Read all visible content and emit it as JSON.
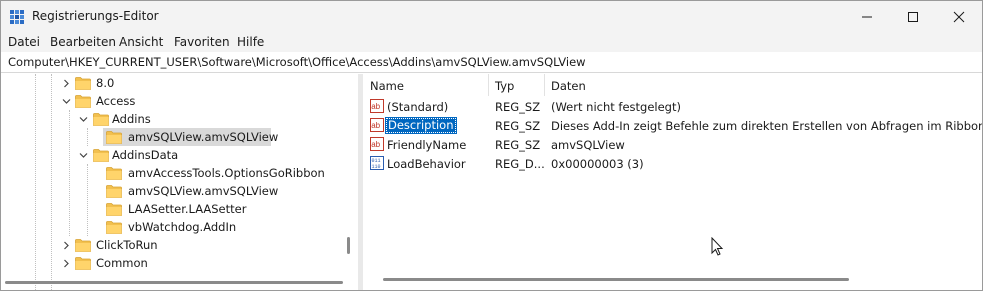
{
  "window": {
    "title": "Registrierungs-Editor",
    "accent_color": "#0067c0"
  },
  "title_buttons": {
    "minimize_icon": "minimize-icon",
    "maximize_icon": "maximize-icon",
    "close_icon": "close-icon"
  },
  "menu": [
    "Datei",
    "Bearbeiten",
    "Ansicht",
    "Favoriten",
    "Hilfe"
  ],
  "address": {
    "path": "Computer\\HKEY_CURRENT_USER\\Software\\Microsoft\\Office\\Access\\Addins\\amvSQLView.amvSQLView"
  },
  "tree": {
    "nodes": [
      {
        "label": "8.0",
        "level": 3,
        "expander": "collapsed"
      },
      {
        "label": "Access",
        "level": 3,
        "expander": "expanded"
      },
      {
        "label": "Addins",
        "level": 4,
        "expander": "expanded"
      },
      {
        "label": "amvSQLView.amvSQLView",
        "level": 5,
        "expander": "none",
        "selected": true
      },
      {
        "label": "AddinsData",
        "level": 4,
        "expander": "expanded"
      },
      {
        "label": "amvAccessTools.OptionsGoRibbon",
        "level": 5,
        "expander": "none"
      },
      {
        "label": "amvSQLView.amvSQLView",
        "level": 5,
        "expander": "none"
      },
      {
        "label": "LAASetter.LAASetter",
        "level": 5,
        "expander": "none"
      },
      {
        "label": "vbWatchdog.AddIn",
        "level": 5,
        "expander": "none"
      },
      {
        "label": "ClickToRun",
        "level": 3,
        "expander": "collapsed"
      },
      {
        "label": "Common",
        "level": 3,
        "expander": "collapsed"
      }
    ]
  },
  "values": {
    "columns": {
      "name": "Name",
      "type": "Typ",
      "data": "Daten"
    },
    "rows": [
      {
        "name": "(Standard)",
        "type": "REG_SZ",
        "data": "(Wert nicht festgelegt)",
        "icon": "string-value-icon"
      },
      {
        "name": "Description",
        "type": "REG_SZ",
        "data": "Dieses Add-In zeigt Befehle zum direkten Erstellen von Abfragen im Ribbon an.",
        "icon": "string-value-icon",
        "selected": true
      },
      {
        "name": "FriendlyName",
        "type": "REG_SZ",
        "data": "amvSQLView",
        "icon": "string-value-icon"
      },
      {
        "name": "LoadBehavior",
        "type": "REG_D...",
        "data": "0x00000003 (3)",
        "icon": "dword-value-icon"
      }
    ]
  }
}
